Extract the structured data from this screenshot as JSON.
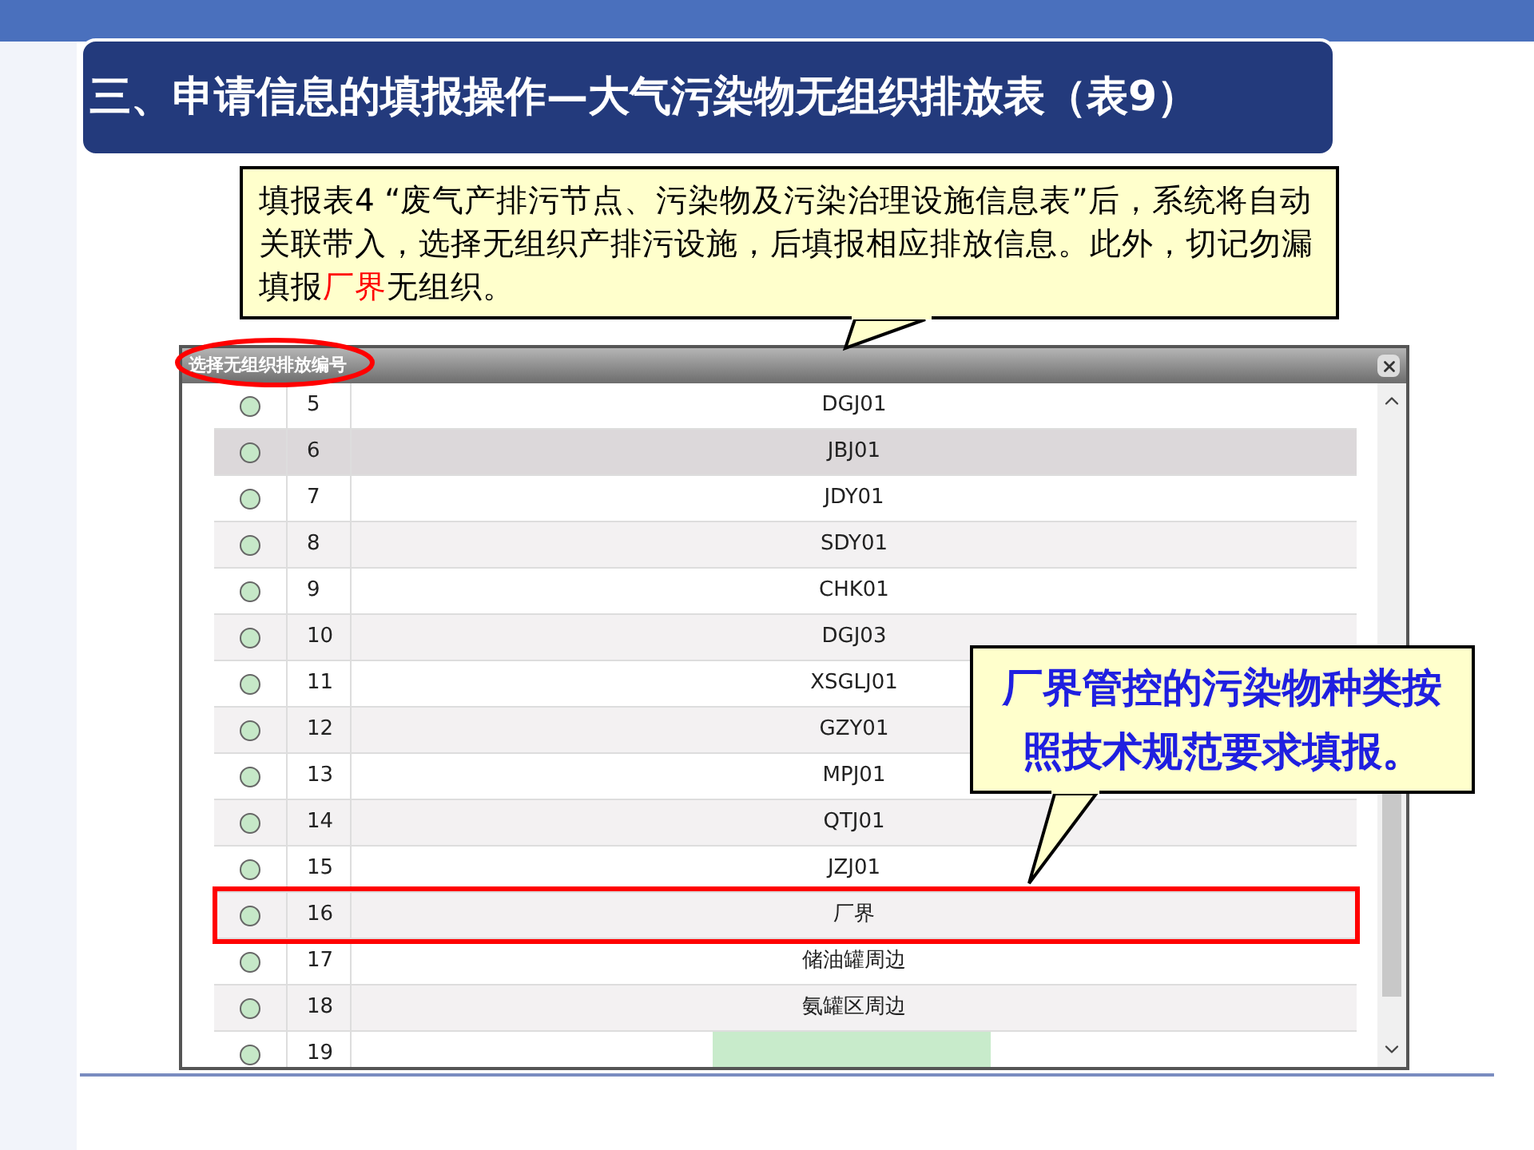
{
  "slide_title": "三、申请信息的填报操作—大气污染物无组织排放表（表9）",
  "callout_top": {
    "segments": [
      {
        "text": "填报表4 “废气产排污节点、污染物及污染治理设施信息表”后，系统将自动关联带入，选择无组织产排污设施，后填报相应排放信息。此外，切记勿漏填报",
        "highlight": false
      },
      {
        "text": "厂界",
        "highlight": true
      },
      {
        "text": "无组织。",
        "highlight": false
      }
    ]
  },
  "dialog": {
    "title": "选择无组织排放编号",
    "rows": [
      {
        "number": "5",
        "code": "DGJ01",
        "selected": false,
        "editing": false
      },
      {
        "number": "6",
        "code": "JBJ01",
        "selected": true,
        "editing": false
      },
      {
        "number": "7",
        "code": "JDY01",
        "selected": false,
        "editing": false
      },
      {
        "number": "8",
        "code": "SDY01",
        "selected": false,
        "editing": false
      },
      {
        "number": "9",
        "code": "CHK01",
        "selected": false,
        "editing": false
      },
      {
        "number": "10",
        "code": "DGJ03",
        "selected": false,
        "editing": false
      },
      {
        "number": "11",
        "code": "XSGLJ01",
        "selected": false,
        "editing": false
      },
      {
        "number": "12",
        "code": "GZY01",
        "selected": false,
        "editing": false
      },
      {
        "number": "13",
        "code": "MPJ01",
        "selected": false,
        "editing": false
      },
      {
        "number": "14",
        "code": "QTJ01",
        "selected": false,
        "editing": false
      },
      {
        "number": "15",
        "code": "JZJ01",
        "selected": false,
        "editing": false
      },
      {
        "number": "16",
        "code": "厂界",
        "selected": false,
        "editing": false
      },
      {
        "number": "17",
        "code": "储油罐周边",
        "selected": false,
        "editing": false
      },
      {
        "number": "18",
        "code": "氨罐区周边",
        "selected": false,
        "editing": false
      },
      {
        "number": "19",
        "code": "",
        "selected": false,
        "editing": true
      }
    ]
  },
  "callout_right": {
    "text": "厂界管控的污染物种类按照技术规范要求填报。"
  }
}
